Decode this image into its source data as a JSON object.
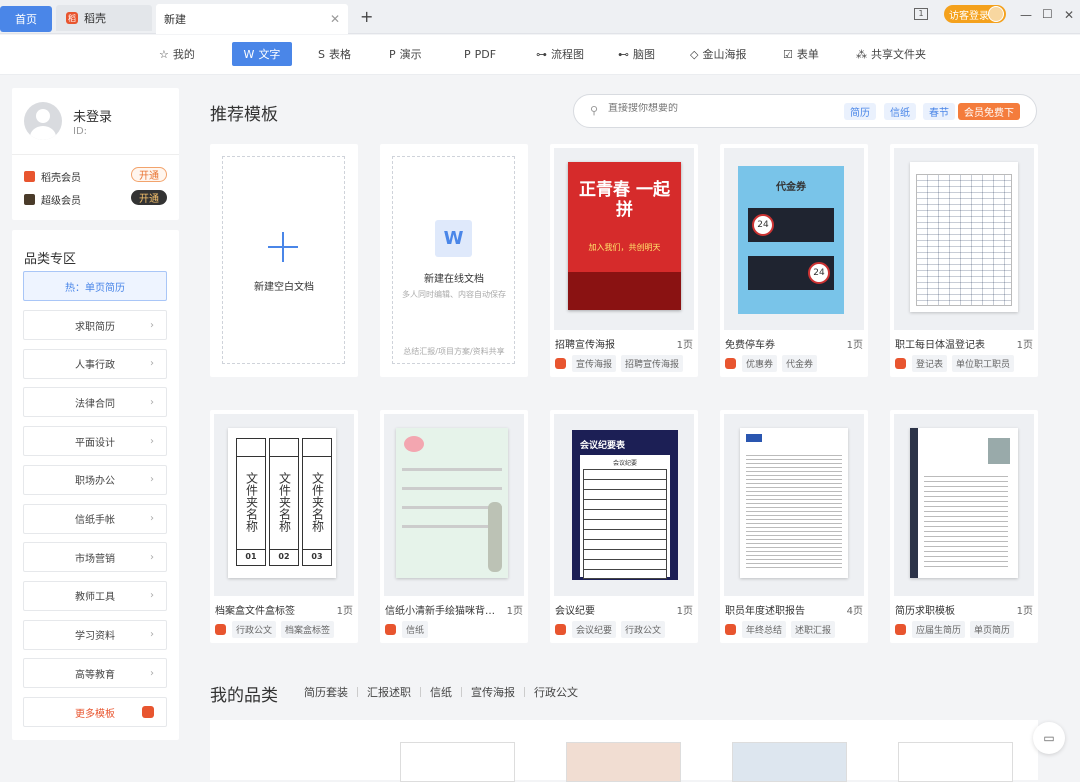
{
  "tabs": {
    "home": "首页",
    "docer": "稻壳",
    "new_tab": "新建"
  },
  "window": {
    "login": "访客登录"
  },
  "toolbar": [
    {
      "label": "我的",
      "icon": "☆"
    },
    {
      "label": "文字",
      "icon": "W"
    },
    {
      "label": "表格",
      "icon": "S"
    },
    {
      "label": "演示",
      "icon": "P"
    },
    {
      "label": "PDF",
      "icon": "P"
    },
    {
      "label": "流程图",
      "icon": "⊶"
    },
    {
      "label": "脑图",
      "icon": "⊷"
    },
    {
      "label": "金山海报",
      "icon": "◇"
    },
    {
      "label": "表单",
      "icon": "☑"
    },
    {
      "label": "共享文件夹",
      "icon": "⁂"
    }
  ],
  "user": {
    "name": "未登录",
    "id_label": "ID:",
    "vip1": "稻壳会员",
    "vip1_btn": "开通",
    "vip2": "超级会员",
    "vip2_btn": "开通"
  },
  "categories": {
    "title": "品类专区",
    "hot": "热：单页简历",
    "items": [
      "求职简历",
      "人事行政",
      "法律合同",
      "平面设计",
      "职场办公",
      "信纸手帐",
      "市场营销",
      "教师工具",
      "学习资料",
      "高等教育"
    ],
    "more": "更多模板"
  },
  "recommend": {
    "title": "推荐模板",
    "search_placeholder": "直接搜你想要的",
    "tags": [
      "简历",
      "信纸",
      "春节"
    ],
    "free_tag": "会员免费下"
  },
  "blank": {
    "new_blank": "新建空白文档",
    "new_online": "新建在线文档",
    "online_sub": "多人同时编辑、内容自动保存",
    "online_foot": "总结汇报/项目方案/资料共享"
  },
  "templates": [
    {
      "title": "招聘宣传海报",
      "pages": "1页",
      "tags": [
        "宣传海报",
        "招聘宣传海报"
      ]
    },
    {
      "title": "免费停车券",
      "pages": "1页",
      "tags": [
        "优惠券",
        "代金券"
      ]
    },
    {
      "title": "职工每日体温登记表",
      "pages": "1页",
      "tags": [
        "登记表",
        "单位职工职员"
      ]
    },
    {
      "title": "档案盒文件盒标签",
      "pages": "1页",
      "tags": [
        "行政公文",
        "档案盒标签"
      ]
    },
    {
      "title": "信纸小清新手绘猫咪背…",
      "pages": "1页",
      "tags": [
        "信纸"
      ]
    },
    {
      "title": "会议纪要",
      "pages": "1页",
      "tags": [
        "会议纪要",
        "行政公文"
      ]
    },
    {
      "title": "职员年度述职报告",
      "pages": "4页",
      "tags": [
        "年终总结",
        "述职汇报"
      ]
    },
    {
      "title": "简历求职模板",
      "pages": "1页",
      "tags": [
        "应届生简历",
        "单页简历"
      ]
    }
  ],
  "thumb_text": {
    "poster_big": "正青春 一起拼",
    "poster_sub": "加入我们，共创明天",
    "coupon_title": "代金券",
    "coupon_num": "24",
    "folder_big": "文件夹名称",
    "folder_nums": [
      "01",
      "02",
      "03"
    ],
    "meeting_title": "会议纪要表",
    "meeting_sub": "会议纪要"
  },
  "my_category": {
    "title": "我的品类",
    "items": [
      "简历套装",
      "汇报述职",
      "信纸",
      "宣传海报",
      "行政公文"
    ]
  },
  "colors": {
    "accent": "#4a86e8",
    "docer": "#e8552f",
    "vip_orange": "#f47c3c"
  }
}
